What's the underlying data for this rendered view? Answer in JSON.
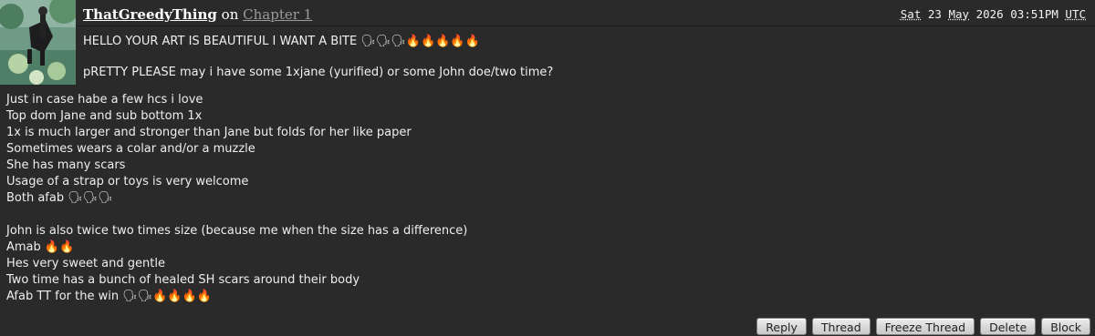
{
  "comment": {
    "author": "ThatGreedyThing",
    "on_word": "on",
    "chapter": "Chapter 1",
    "timestamp": {
      "day": "Sat",
      "date": "23",
      "month": "May",
      "year_time": "2026 03:51PM",
      "tz": "UTC"
    },
    "top_lines": [
      "HELLO YOUR ART IS BEAUTIFUL I WANT A BITE 🗣🗣🗣🔥🔥🔥🔥🔥",
      "pRETTY PLEASE may i have some 1xjane (yurified) or some John doe/two time?"
    ],
    "lines": [
      "Just in case habe a few hcs i love",
      "Top dom Jane and sub bottom 1x",
      "1x is much larger and stronger than Jane but folds for her like paper",
      "Sometimes wears a colar and/or a muzzle",
      "She has many scars",
      "Usage of a strap or toys is very welcome",
      "Both afab 🗣🗣🗣",
      "",
      "John is also twice two times size (because me when the size has a difference)",
      "Amab 🔥🔥",
      "Hes very sweet and gentle",
      "Two time has a bunch of healed SH scars around their body",
      "Afab TT for the win 🗣🗣🔥🔥🔥🔥"
    ],
    "actions": {
      "reply": "Reply",
      "thread": "Thread",
      "freeze": "Freeze Thread",
      "delete": "Delete",
      "block": "Block"
    }
  }
}
